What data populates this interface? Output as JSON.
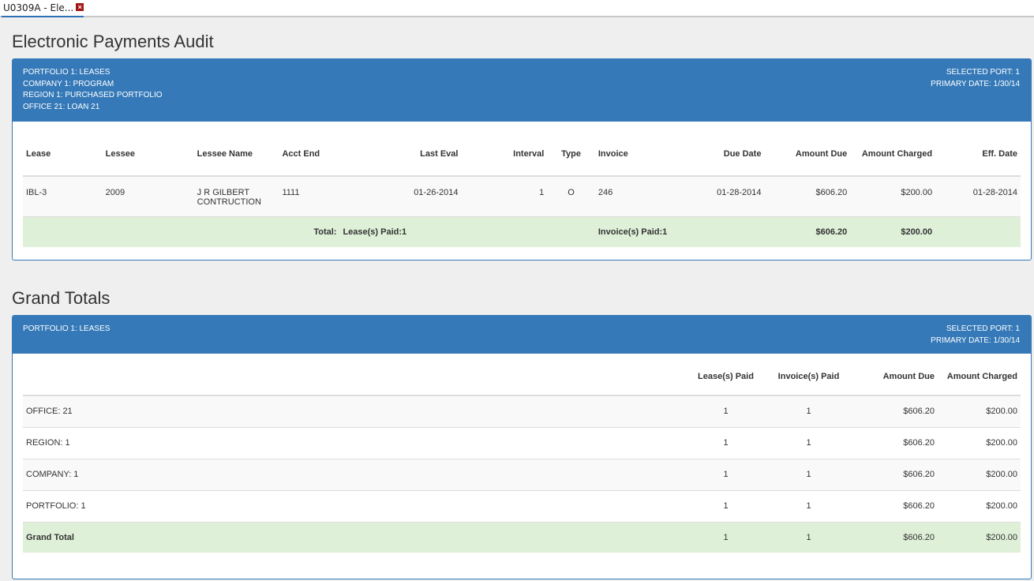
{
  "tab": {
    "label": "U0309A - Ele...",
    "close": "×"
  },
  "audit": {
    "title": "Electronic Payments Audit",
    "header_left": [
      "PORTFOLIO  1:  LEASES",
      "COMPANY  1:  PROGRAM",
      "REGION  1:  PURCHASED PORTFOLIO",
      "OFFICE  21:  LOAN 21"
    ],
    "header_right": [
      "SELECTED PORT: 1",
      "PRIMARY DATE: 1/30/14"
    ],
    "columns": [
      "Lease",
      "Lessee",
      "Lessee Name",
      "Acct End",
      "Last Eval",
      "Interval",
      "Type",
      "Invoice",
      "Due Date",
      "Amount Due",
      "Amount Charged",
      "Eff. Date"
    ],
    "rows": [
      [
        "IBL-3",
        "2009",
        "J R GILBERT CONTRUCTION",
        "1111",
        "01-26-2014",
        "1",
        "O",
        "246",
        "01-28-2014",
        "$606.20",
        "$200.00",
        "01-28-2014"
      ]
    ],
    "total": {
      "label": "Total:",
      "leases_paid": "Lease(s) Paid:1",
      "invoices_paid": "Invoice(s) Paid:1",
      "amount_due": "$606.20",
      "amount_charged": "$200.00"
    }
  },
  "grand": {
    "title": "Grand Totals",
    "header_left": [
      "PORTFOLIO  1:  LEASES"
    ],
    "header_right": [
      "SELECTED PORT: 1",
      "PRIMARY DATE: 1/30/14"
    ],
    "columns": [
      "",
      "Lease(s) Paid",
      "Invoice(s) Paid",
      "Amount Due",
      "Amount Charged"
    ],
    "rows": [
      [
        "OFFICE: 21",
        "1",
        "1",
        "$606.20",
        "$200.00"
      ],
      [
        "REGION: 1",
        "1",
        "1",
        "$606.20",
        "$200.00"
      ],
      [
        "COMPANY: 1",
        "1",
        "1",
        "$606.20",
        "$200.00"
      ],
      [
        "PORTFOLIO: 1",
        "1",
        "1",
        "$606.20",
        "$200.00"
      ]
    ],
    "grand_total": [
      "Grand Total",
      "1",
      "1",
      "$606.20",
      "$200.00"
    ]
  }
}
